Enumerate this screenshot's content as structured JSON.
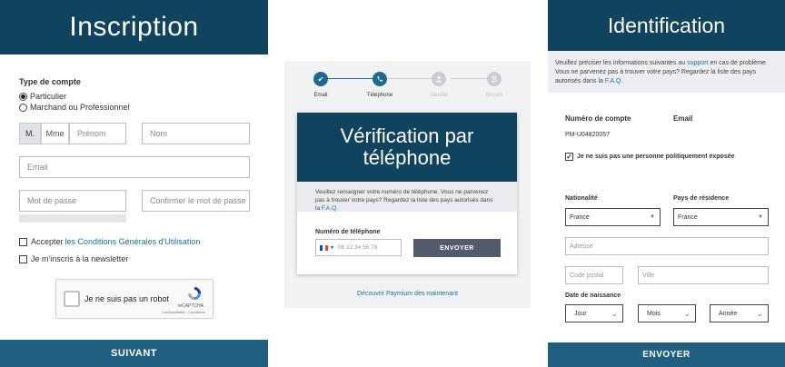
{
  "inscription": {
    "title": "Inscription",
    "account_type_label": "Type de compte",
    "radio_options": [
      "Particulier",
      "Marchand ou Professionnel"
    ],
    "civility": [
      "M.",
      "Mme"
    ],
    "placeholders": {
      "prenom": "Prénom",
      "nom": "Nom",
      "email": "Email",
      "password": "Mot de passe",
      "confirm": "Confirmer le mot de passe"
    },
    "accept_prefix": "Accepter ",
    "accept_link": "les Conditions Générales d'Utilisation",
    "newsletter": "Je m'inscris à la newsletter",
    "captcha": {
      "label": "Je ne suis pas un robot",
      "brand": "reCAPTCHA",
      "privacy": "Confidentialité - Conditions"
    },
    "submit": "SUIVANT"
  },
  "verification": {
    "steps": [
      {
        "label": "Email",
        "icon": "check-icon",
        "state": "done"
      },
      {
        "label": "Téléphone",
        "icon": "phone-icon",
        "state": "done"
      },
      {
        "label": "Identité",
        "icon": "person-icon",
        "state": "todo"
      },
      {
        "label": "Bitcoin",
        "icon": "bitcoin-icon",
        "state": "todo"
      }
    ],
    "title": "Vérification par téléphone",
    "notice": "Veuillez renseigner votre numéro de téléphone. Vous ne parvenez pas à trouver votre pays? Regardez la liste des pays autorisés dans la ",
    "notice_link": "F.A.Q.",
    "phone_label": "Numéro de téléphone",
    "phone_placeholder": "06 12 34 56 78",
    "send": "ENVOYER",
    "discover": "Découvrir Paymium dès maintenant"
  },
  "identification": {
    "title": "Identification",
    "notice_a": "Veuillez préciser les informations suivantes au ",
    "notice_link1": "support",
    "notice_b": " en cas de problème. Vous ne parvenez pas à trouver votre pays? Regardez la liste des pays autorisés dans la ",
    "notice_link2": "F.A.Q.",
    "account_label": "Numéro de compte",
    "account_value": "PM-U04820057",
    "email_label": "Email",
    "pep_label": "Je ne suis pas une personne politiquement exposée",
    "nationality_label": "Nationalité",
    "nationality_value": "France",
    "residence_label": "Pays de résidence",
    "residence_value": "France",
    "address_ph": "Adresse",
    "postal_ph": "Code postal",
    "city_ph": "Ville",
    "birth_label": "Date de naissance",
    "day": "Jour",
    "month": "Mois",
    "year": "Année",
    "submit": "ENVOYER"
  },
  "colors": {
    "header_navy": "#10435e",
    "footer_blue": "#205f80",
    "link_blue": "#1f6e9e",
    "send_button_gray": "#545c6c"
  }
}
